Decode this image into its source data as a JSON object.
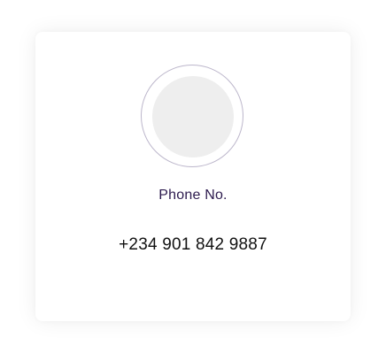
{
  "contact": {
    "label": "Phone No.",
    "value": "+234 901 842 9887"
  },
  "colors": {
    "label": "#2c1a4e",
    "value": "#111111",
    "avatar_fill": "#eeeeee",
    "avatar_ring": "#bcb6cb"
  }
}
